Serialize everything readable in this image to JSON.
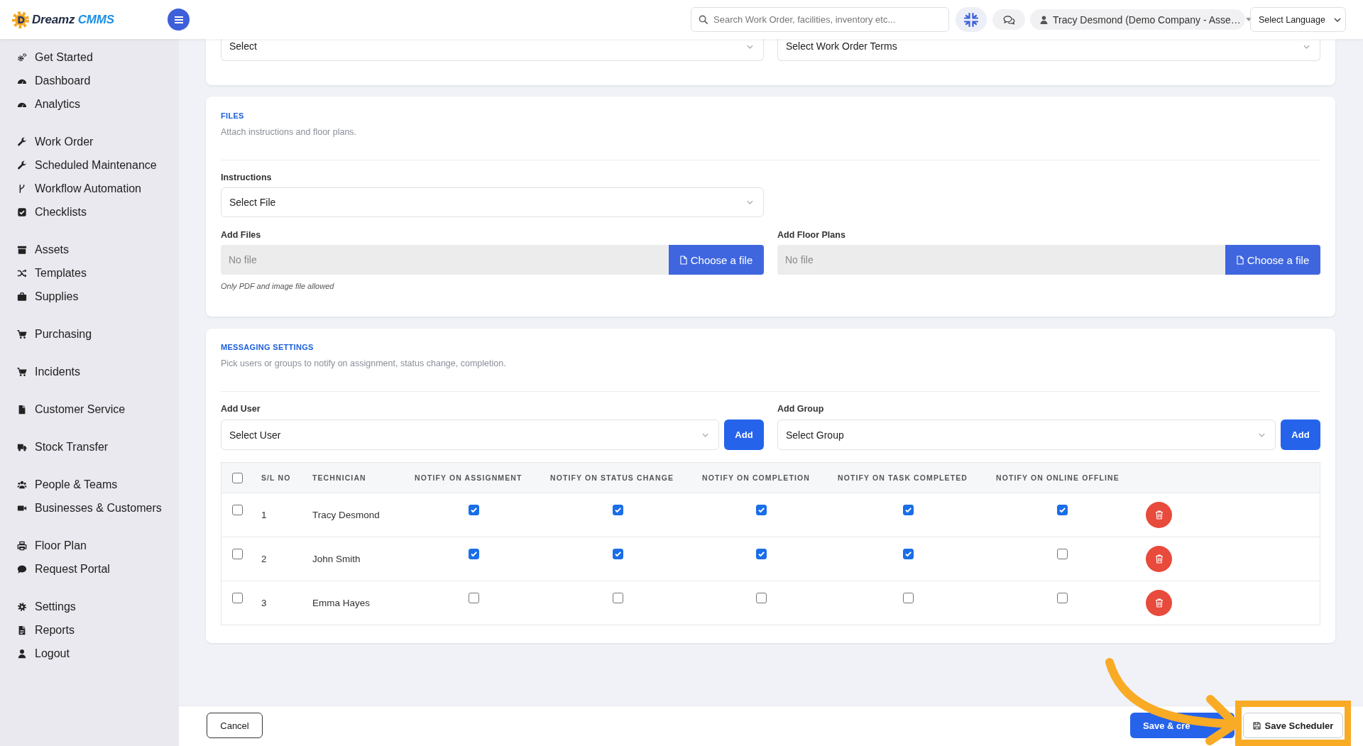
{
  "header": {
    "logo": {
      "brand": "Dreamz",
      "accent": "CMMS"
    },
    "search": {
      "placeholder": "Search Work Order, facilities, inventory etc..."
    },
    "user_menu": {
      "label": "Tracy Desmond (Demo Company - Asse…"
    },
    "language_select": {
      "value": "Select Language"
    }
  },
  "sidebar": {
    "groups": [
      {
        "items": [
          {
            "label": "Get Started",
            "selected": false
          },
          {
            "label": "Dashboard",
            "selected": false
          },
          {
            "label": "Analytics",
            "selected": false
          }
        ]
      },
      {
        "items": [
          {
            "label": "Work Order",
            "selected": false
          },
          {
            "label": "Scheduled Maintenance",
            "selected": false
          },
          {
            "label": "Workflow Automation",
            "selected": false
          },
          {
            "label": "Checklists",
            "selected": false
          }
        ]
      },
      {
        "items": [
          {
            "label": "Assets",
            "selected": false
          },
          {
            "label": "Templates",
            "selected": false
          },
          {
            "label": "Supplies",
            "selected": false
          }
        ]
      },
      {
        "items": [
          {
            "label": "Purchasing",
            "selected": false
          }
        ]
      },
      {
        "items": [
          {
            "label": "Incidents",
            "selected": false
          }
        ]
      },
      {
        "items": [
          {
            "label": "Customer Service",
            "selected": false
          }
        ]
      },
      {
        "items": [
          {
            "label": "Stock Transfer",
            "selected": false
          }
        ]
      },
      {
        "items": [
          {
            "label": "People & Teams",
            "selected": false
          },
          {
            "label": "Businesses & Customers",
            "selected": false
          }
        ]
      },
      {
        "items": [
          {
            "label": "Floor Plan",
            "selected": false
          },
          {
            "label": "Request Portal",
            "selected": false
          }
        ]
      },
      {
        "items": [
          {
            "label": "Settings",
            "selected": false
          },
          {
            "label": "Reports",
            "selected": false
          },
          {
            "label": "Logout",
            "selected": false
          }
        ]
      }
    ]
  },
  "work_order_fields": {
    "fields": [
      {
        "value": "Select"
      },
      {
        "value": "Select Work Order Terms"
      }
    ]
  },
  "files": {
    "title": "FILES",
    "subtitle": "Attach instructions and floor plans.",
    "instructions": {
      "label": "Instructions",
      "value": "Select File"
    },
    "uploads": [
      {
        "label": "Add Files",
        "placeholder": "No file",
        "button": "Choose a file",
        "note": "Only PDF and image file allowed"
      },
      {
        "label": "Add Floor Plans",
        "placeholder": "No file",
        "button": "Choose a file"
      }
    ]
  },
  "messaging": {
    "title": "MESSAGING SETTINGS",
    "subtitle": "Pick users or groups to notify on assignment, status change, completion.",
    "pickers": [
      {
        "label": "Add User",
        "value": "Select User",
        "button": "Add"
      },
      {
        "label": "Add Group",
        "value": "Select Group",
        "button": "Add"
      }
    ],
    "table": {
      "select_all": {
        "checked": false
      },
      "columns": [
        "S/L NO",
        "TECHNICIAN",
        "NOTIFY ON ASSIGNMENT",
        "NOTIFY ON STATUS CHANGE",
        "NOTIFY ON COMPLETION",
        "NOTIFY ON TASK COMPLETED",
        "NOTIFY ON ONLINE OFFLINE"
      ],
      "rows": [
        {
          "checked": false,
          "sl_no": "1",
          "technician": "Tracy Desmond",
          "notify": [
            {
              "checked": true
            },
            {
              "checked": true
            },
            {
              "checked": true
            },
            {
              "checked": true
            },
            {
              "checked": true
            }
          ]
        },
        {
          "checked": false,
          "sl_no": "2",
          "technician": "John Smith",
          "notify": [
            {
              "checked": true
            },
            {
              "checked": true
            },
            {
              "checked": true
            },
            {
              "checked": true
            },
            {
              "checked": false
            }
          ]
        },
        {
          "checked": false,
          "sl_no": "3",
          "technician": "Emma Hayes",
          "notify": [
            {
              "checked": false
            },
            {
              "checked": false
            },
            {
              "checked": false
            },
            {
              "checked": false
            },
            {
              "checked": false
            }
          ]
        }
      ]
    }
  },
  "footer": {
    "cancel": {
      "label": "Cancel"
    },
    "actions": [
      {
        "kind": "primary",
        "label": "Save & cre",
        "highlighted": false
      },
      {
        "kind": "outline",
        "label": "Save Scheduler",
        "highlighted": true
      }
    ]
  }
}
